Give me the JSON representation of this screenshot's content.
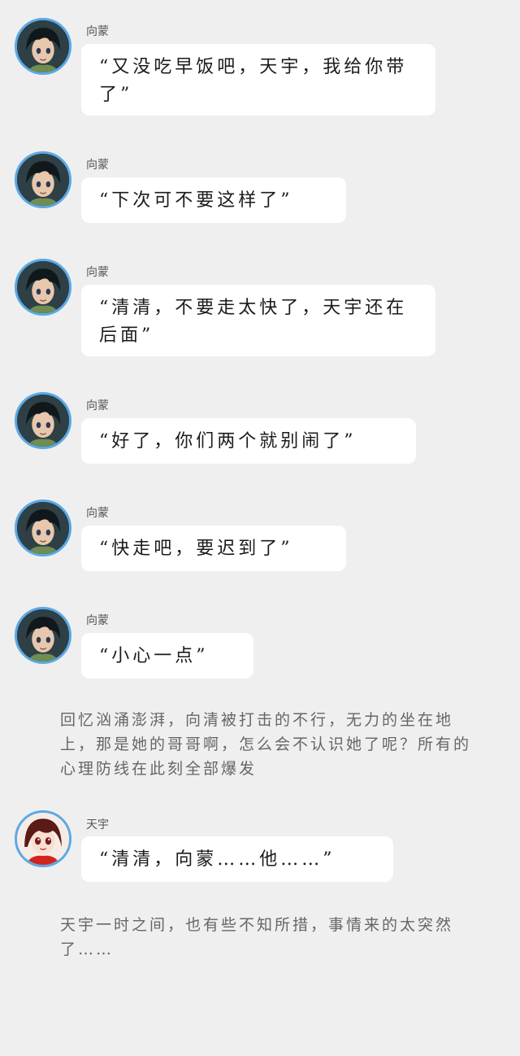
{
  "messages": [
    {
      "speaker": "向蒙",
      "text": "“又没吃早饭吧，天宇，我给你带了”"
    },
    {
      "speaker": "向蒙",
      "text": "“下次可不要这样了”"
    },
    {
      "speaker": "向蒙",
      "text": "“清清，不要走太快了，天宇还在后面”"
    },
    {
      "speaker": "向蒙",
      "text": "“好了，你们两个就别闹了”"
    },
    {
      "speaker": "向蒙",
      "text": "“快走吧，要迟到了”"
    },
    {
      "speaker": "向蒙",
      "text": "“小心一点”"
    },
    {
      "speaker": "天宇",
      "text": "“清清，向蒙……他……”"
    }
  ],
  "narration": [
    "回忆汹涌澎湃，向清被打击的不行，无力的坐在地上，那是她的哥哥啊，怎么会不认识她了呢？所有的心理防线在此刻全部爆发",
    "天宇一时之间，也有些不知所措，事情来的太突然了……"
  ],
  "colors": {
    "background": "#efefef",
    "bubble": "#ffffff",
    "avatar_border": "#5aa9e6",
    "narration_text": "#666666"
  },
  "icons": {
    "xiangmeng_avatar": "boy-with-dark-hair-avatar",
    "tianyu_avatar": "girl-with-red-outfit-avatar"
  }
}
